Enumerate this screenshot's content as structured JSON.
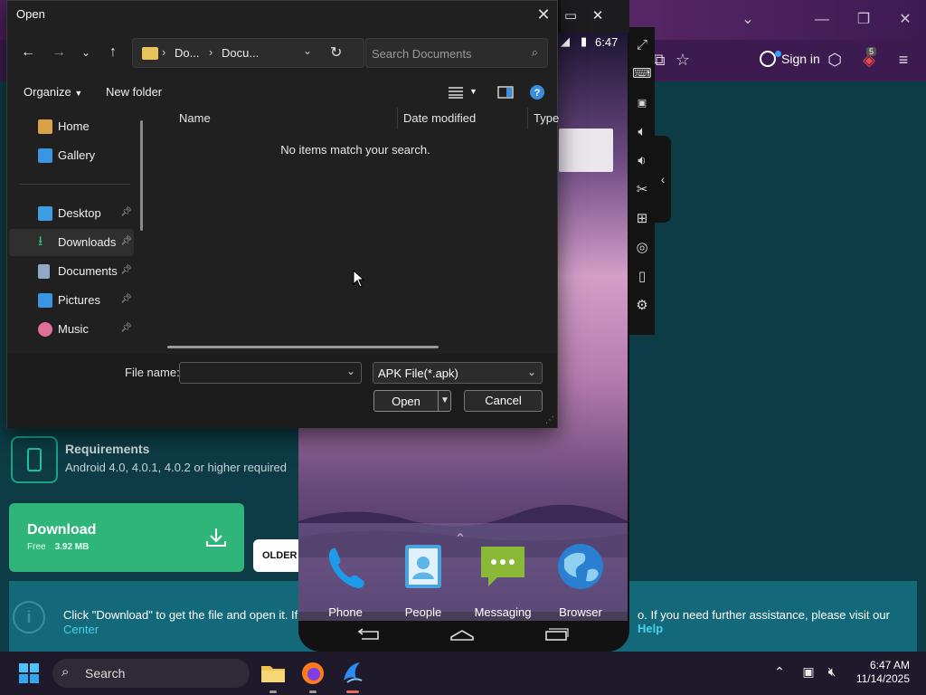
{
  "dialog": {
    "title": "Open",
    "breadcrumb": [
      "Do...",
      "Docu..."
    ],
    "search_placeholder": "Search Documents",
    "organize_label": "Organize",
    "new_folder_label": "New folder",
    "nav_items": [
      {
        "label": "Home"
      },
      {
        "label": "Gallery"
      },
      {
        "label": "Desktop"
      },
      {
        "label": "Downloads"
      },
      {
        "label": "Documents"
      },
      {
        "label": "Pictures"
      },
      {
        "label": "Music"
      }
    ],
    "columns": [
      "Name",
      "Date modified",
      "Type"
    ],
    "empty_message": "No items match your search.",
    "file_name_label": "File name:",
    "file_name_value": "",
    "file_type_filter": "APK File(*.apk)",
    "open_label": "Open",
    "cancel_label": "Cancel"
  },
  "emulator": {
    "status_time": "6:47",
    "apps": [
      {
        "label": "Phone",
        "icon": "phone-icon"
      },
      {
        "label": "People",
        "icon": "contacts-icon"
      },
      {
        "label": "Messaging",
        "icon": "messaging-icon"
      },
      {
        "label": "Browser",
        "icon": "globe-icon"
      }
    ]
  },
  "browser": {
    "signin_label": "Sign in",
    "extension_badge": "5"
  },
  "page": {
    "requirements_title": "Requirements",
    "requirements_text": "Android 4.0, 4.0.1, 4.0.2 or higher required",
    "download_label": "Download",
    "download_free": "Free",
    "download_size": "3.92 MB",
    "older_label": "OLDER V",
    "info_text_1": "Click \"Download\" to get the file and open it. If req",
    "info_text_2": "Center",
    "info_text_3_pre": "o. If you need further assistance, please visit our ",
    "info_text_3_link": "Help"
  },
  "taskbar": {
    "search_label": "Search",
    "time": "6:47 AM",
    "date": "11/14/2025"
  },
  "colors": {
    "accent_green": "#2fb57a",
    "link_cyan": "#4ad0e8",
    "dialog_bg": "#202020"
  }
}
